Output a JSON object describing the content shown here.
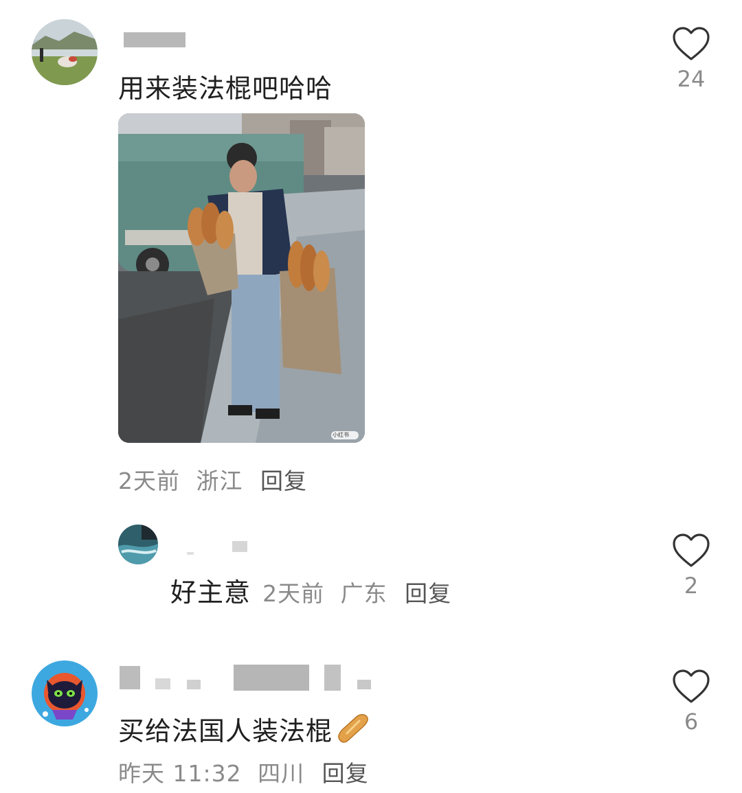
{
  "comments": [
    {
      "text": "用来装法棍吧哈哈",
      "time": "2天前",
      "location": "浙江",
      "reply_label": "回复",
      "likes": "24",
      "photo_watermark": "小红书"
    },
    {
      "text": "好主意",
      "time": "2天前",
      "location": "广东",
      "reply_label": "回复",
      "likes": "2"
    },
    {
      "text": "买给法国人装法棍",
      "time": "昨天 11:32",
      "location": "四川",
      "reply_label": "回复",
      "likes": "6",
      "emoji_icon": "baguette-icon"
    }
  ],
  "colors": {
    "text": "#1f1f1f",
    "meta": "#8a8a8a",
    "reply": "#555555",
    "heart_stroke": "#333333"
  }
}
